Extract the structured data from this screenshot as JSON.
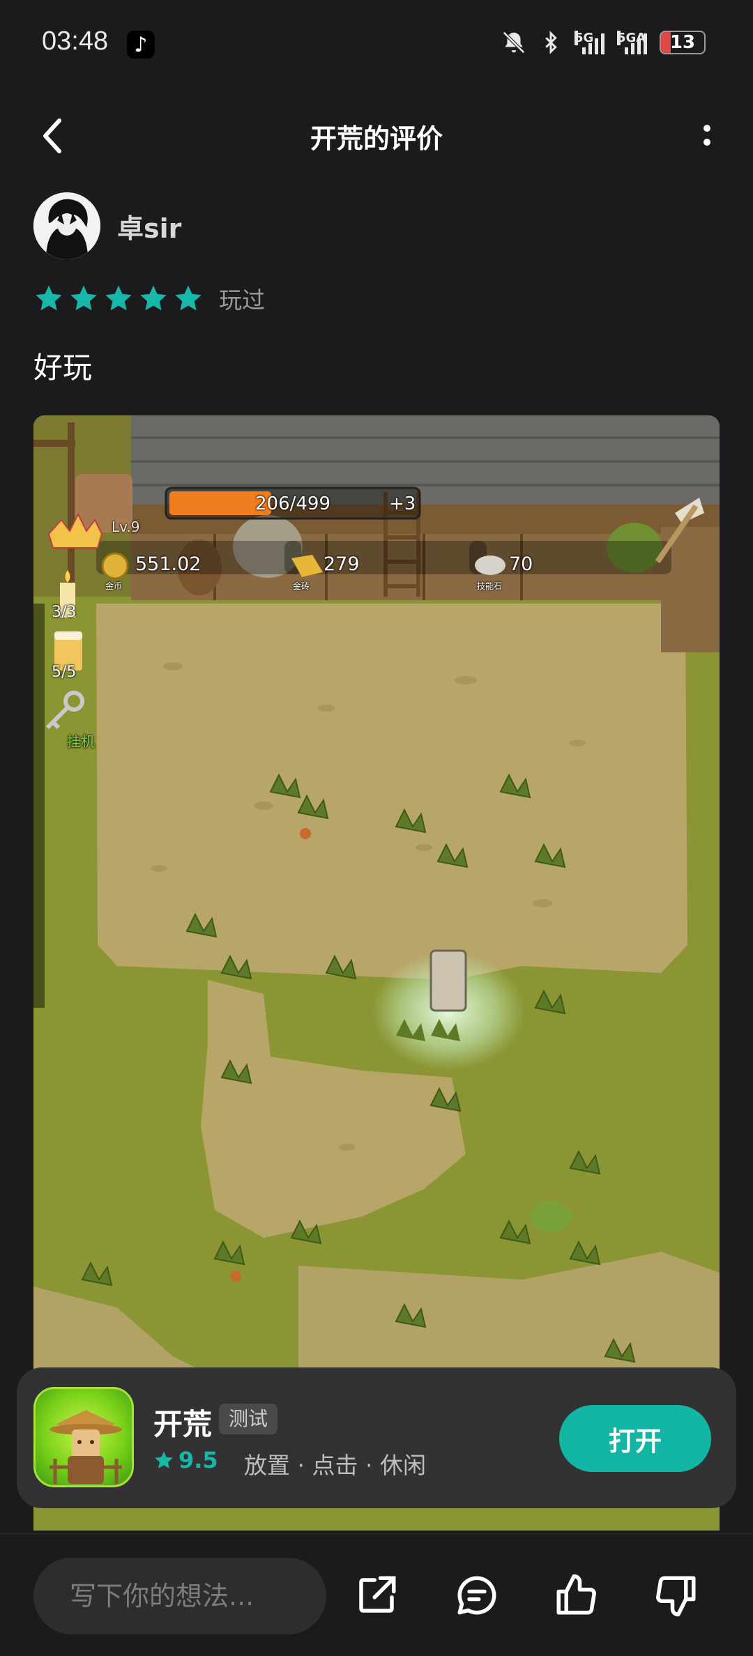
{
  "status_bar": {
    "time": "03:48",
    "app_icon": "tiktok-icon",
    "icons": [
      "mute-bell-icon",
      "bluetooth-icon",
      "signal-5g-icon",
      "signal-5ga-icon"
    ],
    "signal1_label": "5G",
    "signal2_label": "5GA",
    "battery": "13"
  },
  "header": {
    "title": "开荒的评价",
    "back_icon": "back-arrow-icon",
    "more_icon": "more-vertical-icon"
  },
  "review": {
    "username": "卓sir",
    "rating": 5,
    "status": "玩过",
    "text": "好玩"
  },
  "game_screenshot": {
    "level": "Lv.9",
    "exp": "206/499",
    "exp_progress": 0.41,
    "exp_bonus": "+3",
    "gold_coin_value": "551.02",
    "gold_coin_label": "金币",
    "gold_brick_value": "279",
    "gold_brick_label": "金砖",
    "skill_stone_value": "70",
    "skill_stone_label": "技能石",
    "candle_count": "3/3",
    "beer_count": "5/5",
    "idle_label": "挂机"
  },
  "app_card": {
    "name": "开荒",
    "badge": "测试",
    "rating": "9.5",
    "tags": "放置 · 点击 · 休闲",
    "open_label": "打开",
    "accent": "#13b5a5"
  },
  "bottom_bar": {
    "placeholder": "写下你的想法...",
    "icons": [
      "share-icon",
      "comment-icon",
      "like-icon",
      "dislike-icon"
    ]
  }
}
